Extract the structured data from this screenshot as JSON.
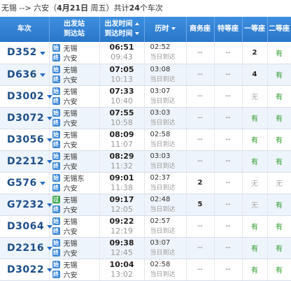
{
  "route": {
    "from": "无锡",
    "arrow": "-->",
    "to": "六安",
    "date_prefix": "（",
    "date": "4月21日",
    "weekday": "周五",
    "date_suffix": "）共计",
    "count": "24",
    "count_suffix": "个车次"
  },
  "headers": {
    "train": "车次",
    "station_from": "出发站",
    "station_to": "到达站",
    "time_dep": "出发时间",
    "time_arr": "到达时间",
    "duration": "历时",
    "business": "商务座",
    "premium": "特等座",
    "first": "一等座",
    "second": "二等座"
  },
  "trains": [
    {
      "no": "D352",
      "from": "无锡",
      "from_icon": "始",
      "to": "六安",
      "to_icon": "终",
      "dep": "06:51",
      "arr": "09:43",
      "dur": "02:52",
      "arrive": "当日到达",
      "business": "--",
      "premium": "--",
      "first": "2",
      "second": "有"
    },
    {
      "no": "D636",
      "from": "无锡",
      "from_icon": "始",
      "to": "六安",
      "to_icon": "终",
      "dep": "07:05",
      "arr": "10:13",
      "dur": "03:08",
      "arrive": "当日到达",
      "business": "--",
      "premium": "--",
      "first": "4",
      "second": "有"
    },
    {
      "no": "D3002",
      "from": "无锡",
      "from_icon": "始",
      "to": "六安",
      "to_icon": "终",
      "dep": "07:33",
      "arr": "10:40",
      "dur": "03:07",
      "arrive": "当日到达",
      "business": "--",
      "premium": "--",
      "first": "无",
      "second": "有"
    },
    {
      "no": "D3072",
      "from": "无锡",
      "from_icon": "始",
      "to": "六安",
      "to_icon": "终",
      "dep": "07:55",
      "arr": "10:58",
      "dur": "03:03",
      "arrive": "当日到达",
      "business": "--",
      "premium": "--",
      "first": "有",
      "second": "有"
    },
    {
      "no": "D3056",
      "from": "无锡",
      "from_icon": "始",
      "to": "六安",
      "to_icon": "终",
      "dep": "08:09",
      "arr": "11:07",
      "dur": "02:58",
      "arrive": "当日到达",
      "business": "--",
      "premium": "--",
      "first": "有",
      "second": "有"
    },
    {
      "no": "D2212",
      "from": "无锡",
      "from_icon": "始",
      "to": "六安",
      "to_icon": "终",
      "dep": "08:29",
      "arr": "11:32",
      "dur": "03:03",
      "arrive": "当日到达",
      "business": "--",
      "premium": "--",
      "first": "有",
      "second": "有"
    },
    {
      "no": "G576",
      "from": "无锡东",
      "from_icon": "始",
      "to": "六安",
      "to_icon": "终",
      "dep": "09:01",
      "arr": "11:38",
      "dur": "02:37",
      "arrive": "当日到达",
      "business": "2",
      "premium": "--",
      "first": "无",
      "second": "无"
    },
    {
      "no": "G7232",
      "from": "无锡",
      "from_icon": "过",
      "to": "六安",
      "to_icon": "终",
      "dep": "09:17",
      "arr": "12:05",
      "dur": "02:48",
      "arrive": "当日到达",
      "business": "5",
      "premium": "--",
      "first": "无",
      "second": "有"
    },
    {
      "no": "D3064",
      "from": "无锡",
      "from_icon": "始",
      "to": "六安",
      "to_icon": "终",
      "dep": "09:22",
      "arr": "12:19",
      "dur": "02:57",
      "arrive": "当日到达",
      "business": "--",
      "premium": "--",
      "first": "有",
      "second": "有"
    },
    {
      "no": "D2216",
      "from": "无锡",
      "from_icon": "始",
      "to": "六安",
      "to_icon": "终",
      "dep": "09:38",
      "arr": "12:45",
      "dur": "03:07",
      "arrive": "当日到达",
      "business": "--",
      "premium": "--",
      "first": "有",
      "second": "有"
    },
    {
      "no": "D3022",
      "from": "无锡",
      "from_icon": "始",
      "to": "六安",
      "to_icon": "终",
      "dep": "10:04",
      "arr": "13:02",
      "dur": "02:58",
      "arrive": "当日到达",
      "business": "--",
      "premium": "--",
      "first": "有",
      "second": "有"
    }
  ]
}
